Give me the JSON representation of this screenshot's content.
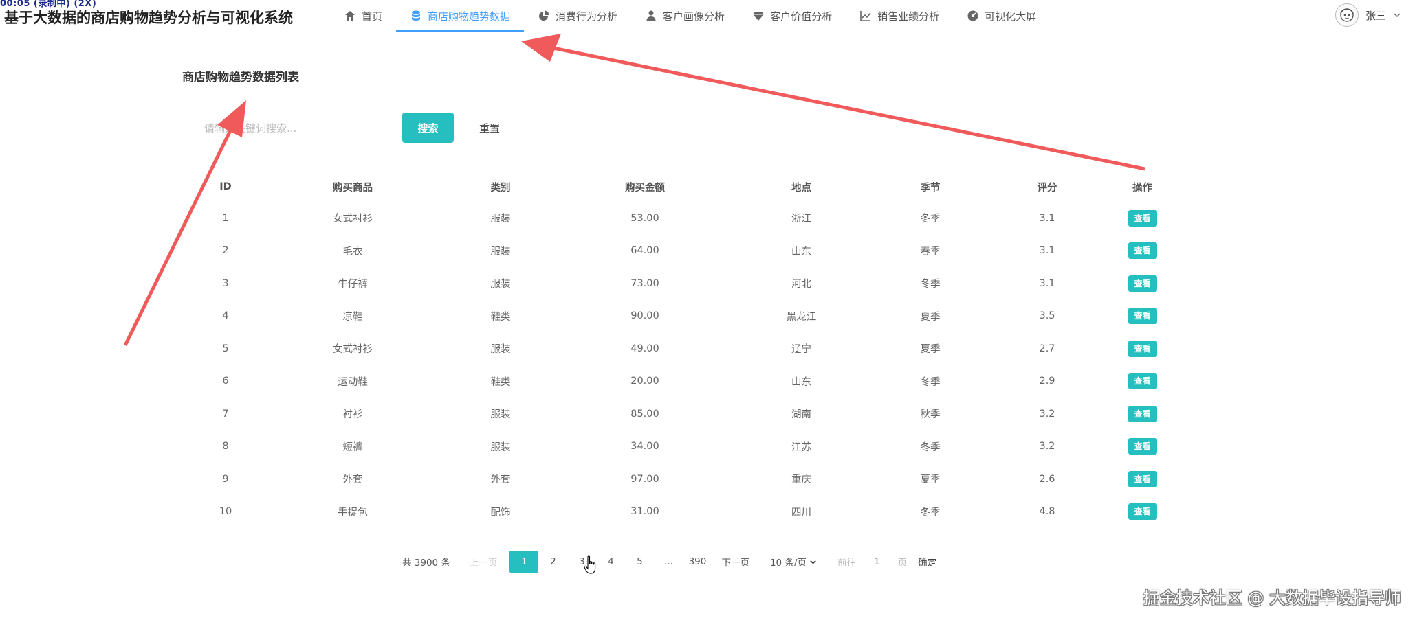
{
  "overlay": {
    "recording_badge": "00:05 (录制中) (2X)",
    "watermark": "掘金技术社区 @ 大数据毕设指导师"
  },
  "header": {
    "app_title": "基于大数据的商店购物趋势分析与可视化系统",
    "nav": [
      {
        "label": "首页",
        "icon": "home-icon",
        "active": false
      },
      {
        "label": "商店购物趋势数据",
        "icon": "database-icon",
        "active": true
      },
      {
        "label": "消费行为分析",
        "icon": "pie-chart-icon",
        "active": false
      },
      {
        "label": "客户画像分析",
        "icon": "user-icon",
        "active": false
      },
      {
        "label": "客户价值分析",
        "icon": "diamond-icon",
        "active": false
      },
      {
        "label": "销售业绩分析",
        "icon": "line-chart-icon",
        "active": false
      },
      {
        "label": "可视化大屏",
        "icon": "dashboard-icon",
        "active": false
      }
    ],
    "user_name": "张三",
    "user_avatar": "avatar-icon"
  },
  "main": {
    "page_title": "商店购物趋势数据列表",
    "search": {
      "placeholder": "请输入关键词搜索...",
      "value": "",
      "search_label": "搜索",
      "reset_label": "重置"
    },
    "table": {
      "columns": [
        "ID",
        "购买商品",
        "类别",
        "购买金额",
        "地点",
        "季节",
        "评分",
        "操作"
      ],
      "view_label": "查看",
      "rows": [
        {
          "id": "1",
          "product": "女式衬衫",
          "category": "服装",
          "amount": "53.00",
          "location": "浙江",
          "season": "冬季",
          "score": "3.1"
        },
        {
          "id": "2",
          "product": "毛衣",
          "category": "服装",
          "amount": "64.00",
          "location": "山东",
          "season": "春季",
          "score": "3.1"
        },
        {
          "id": "3",
          "product": "牛仔裤",
          "category": "服装",
          "amount": "73.00",
          "location": "河北",
          "season": "冬季",
          "score": "3.1"
        },
        {
          "id": "4",
          "product": "凉鞋",
          "category": "鞋类",
          "amount": "90.00",
          "location": "黑龙江",
          "season": "夏季",
          "score": "3.5"
        },
        {
          "id": "5",
          "product": "女式衬衫",
          "category": "服装",
          "amount": "49.00",
          "location": "辽宁",
          "season": "夏季",
          "score": "2.7"
        },
        {
          "id": "6",
          "product": "运动鞋",
          "category": "鞋类",
          "amount": "20.00",
          "location": "山东",
          "season": "冬季",
          "score": "2.9"
        },
        {
          "id": "7",
          "product": "衬衫",
          "category": "服装",
          "amount": "85.00",
          "location": "湖南",
          "season": "秋季",
          "score": "3.2"
        },
        {
          "id": "8",
          "product": "短裤",
          "category": "服装",
          "amount": "34.00",
          "location": "江苏",
          "season": "冬季",
          "score": "3.2"
        },
        {
          "id": "9",
          "product": "外套",
          "category": "外套",
          "amount": "97.00",
          "location": "重庆",
          "season": "夏季",
          "score": "2.6"
        },
        {
          "id": "10",
          "product": "手提包",
          "category": "配饰",
          "amount": "31.00",
          "location": "四川",
          "season": "冬季",
          "score": "4.8"
        }
      ]
    },
    "pagination": {
      "total": "共 3900 条",
      "prev": "上一页",
      "pages": [
        "1",
        "2",
        "3",
        "4",
        "5",
        "...",
        "390"
      ],
      "current": "1",
      "next": "下一页",
      "page_size": "10 条/页",
      "goto_label": "前往",
      "goto_value": "1",
      "goto_unit": "页",
      "confirm": "确定"
    }
  },
  "colors": {
    "accent": "#26bfbf",
    "nav_active": "#409eff",
    "annotation_arrow": "#f05a5a"
  }
}
